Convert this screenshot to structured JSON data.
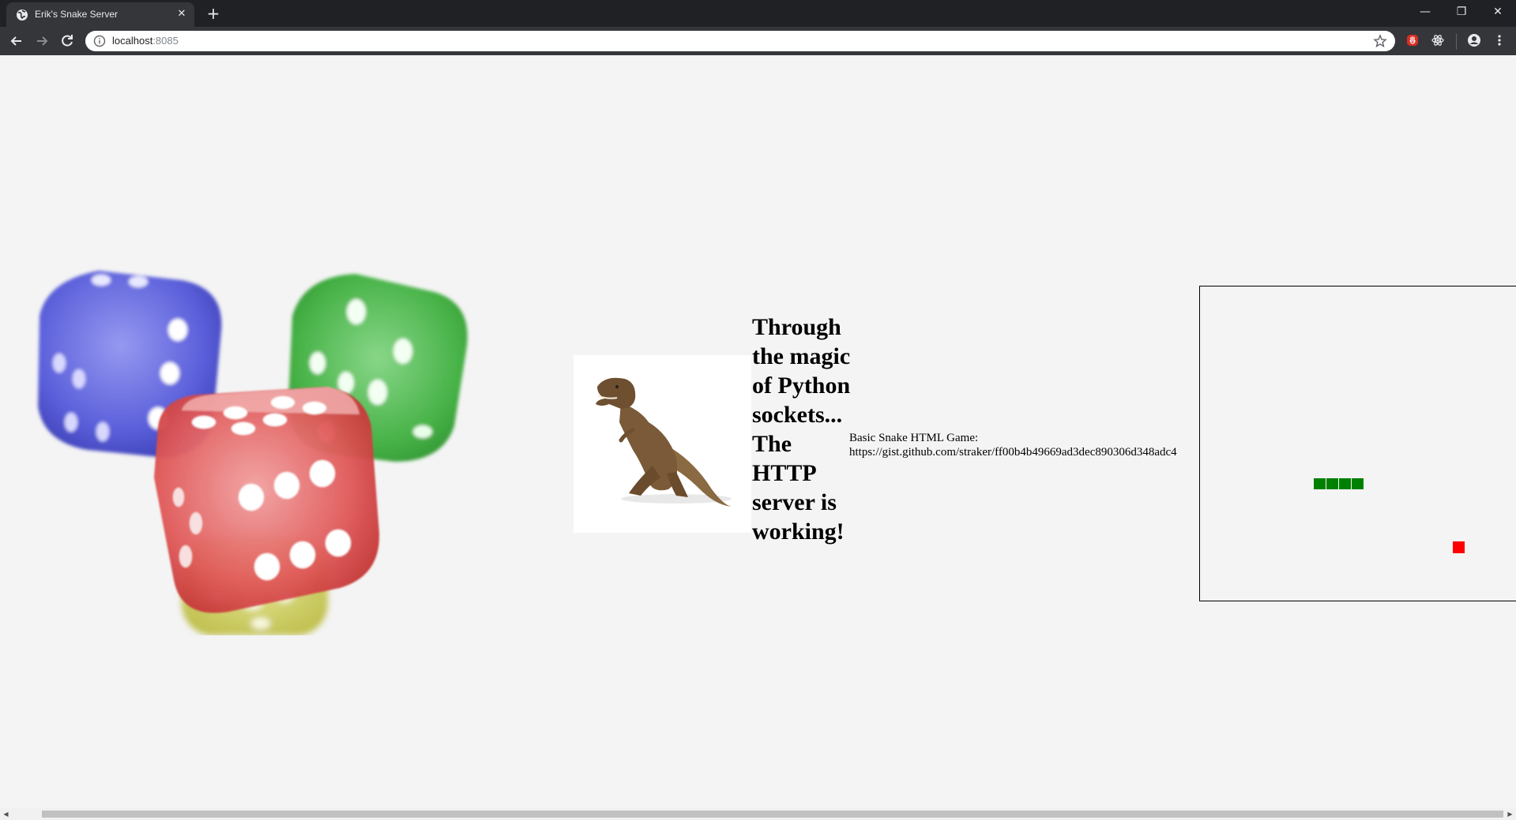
{
  "browser": {
    "tab_title": "Erik's Snake Server",
    "tab_close": "✕",
    "new_tab": "+",
    "url_host": "localhost",
    "url_port": ":8085",
    "window_controls": {
      "minimize": "—",
      "restore": "❐",
      "close": "✕"
    }
  },
  "page": {
    "heading": "Through the magic of Python sockets... The HTTP server is working!",
    "snake_label_line1": "Basic Snake HTML Game:",
    "snake_label_line2": "https://gist.github.com/straker/ff00b4b49669ad3dec890306d348adc4"
  },
  "game": {
    "snake_color": "#008000",
    "food_color": "#ff0000",
    "snake_length": 4
  },
  "scrollbar": {
    "left_arrow": "◀",
    "right_arrow": "▶"
  }
}
